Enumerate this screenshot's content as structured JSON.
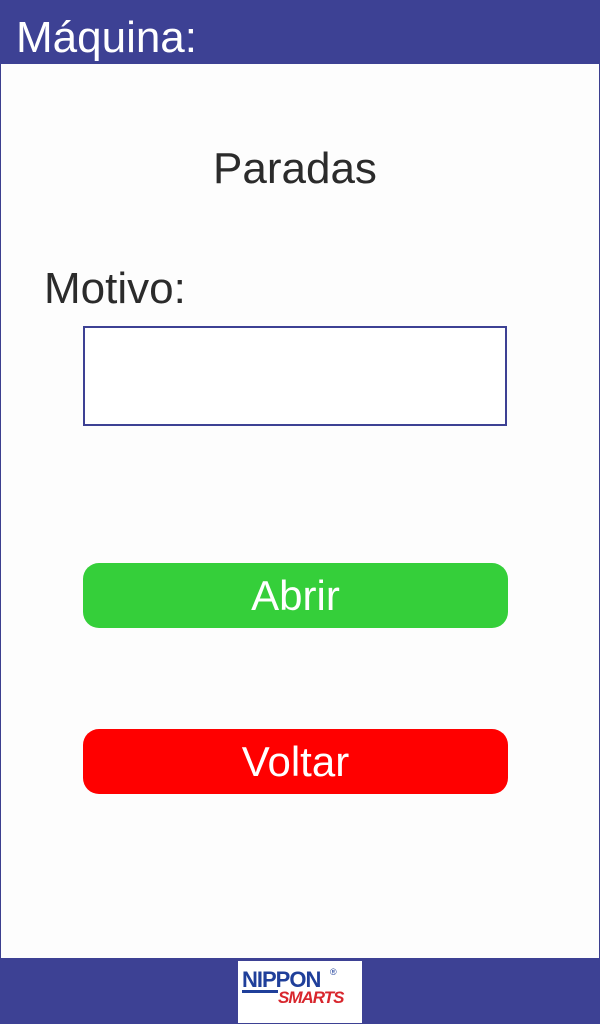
{
  "header": {
    "title": "Máquina:"
  },
  "main": {
    "page_title": "Paradas",
    "motivo_label": "Motivo:",
    "motivo_value": "",
    "motivo_placeholder": ""
  },
  "buttons": {
    "abrir_label": "Abrir",
    "voltar_label": "Voltar"
  },
  "footer": {
    "logo_top_text": "NIPPON",
    "logo_registered": "®",
    "logo_bottom_text": "SMARTS"
  },
  "colors": {
    "header_footer": "#3d4194",
    "abrir_button": "#35cf3a",
    "voltar_button": "#ff0000",
    "text": "#2b2b2b"
  }
}
